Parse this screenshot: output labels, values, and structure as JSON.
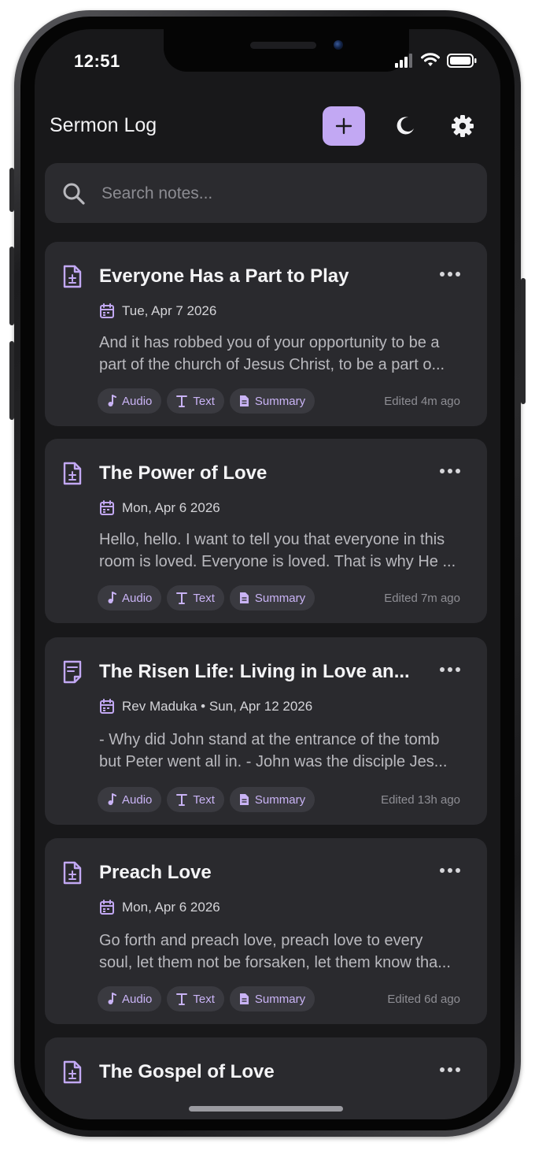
{
  "status_bar": {
    "time": "12:51"
  },
  "header": {
    "title": "Sermon Log"
  },
  "search": {
    "placeholder": "Search notes..."
  },
  "colors": {
    "accent": "#c2a8f3",
    "chip_text": "#c9b3f5",
    "card_bg": "#2a2a2e",
    "screen_bg": "#18181a"
  },
  "notes": [
    {
      "icon": "audio-file-icon",
      "title": "Everyone Has a Part to Play",
      "meta": "Tue, Apr 7 2026",
      "snippet_1": "And it has robbed you of your opportunity to be a",
      "snippet_2": "part of the church of Jesus Christ, to be a part o...",
      "chips": [
        "Audio",
        "Text",
        "Summary"
      ],
      "edited": "Edited 4m ago"
    },
    {
      "icon": "audio-file-icon",
      "title": "The Power of Love",
      "meta": "Mon, Apr 6 2026",
      "snippet_1": "Hello, hello. I want to tell you that everyone in this",
      "snippet_2": "room is loved. Everyone is loved. That is why He ...",
      "chips": [
        "Audio",
        "Text",
        "Summary"
      ],
      "edited": "Edited 7m ago"
    },
    {
      "icon": "text-note-icon",
      "title": "The Risen Life: Living in Love an...",
      "meta": "Rev Maduka • Sun, Apr 12 2026",
      "snippet_1": "- Why did John stand at the entrance of the tomb",
      "snippet_2": "but Peter went all in. - John was the disciple Jes...",
      "chips": [
        "Audio",
        "Text",
        "Summary"
      ],
      "edited": "Edited 13h ago"
    },
    {
      "icon": "audio-file-icon",
      "title": "Preach Love",
      "meta": "Mon, Apr 6 2026",
      "snippet_1": "Go forth and preach love, preach love to every",
      "snippet_2": "soul, let them not be forsaken, let them know tha...",
      "chips": [
        "Audio",
        "Text",
        "Summary"
      ],
      "edited": "Edited 6d ago"
    },
    {
      "icon": "audio-file-icon",
      "title": "The Gospel of Love"
    }
  ]
}
